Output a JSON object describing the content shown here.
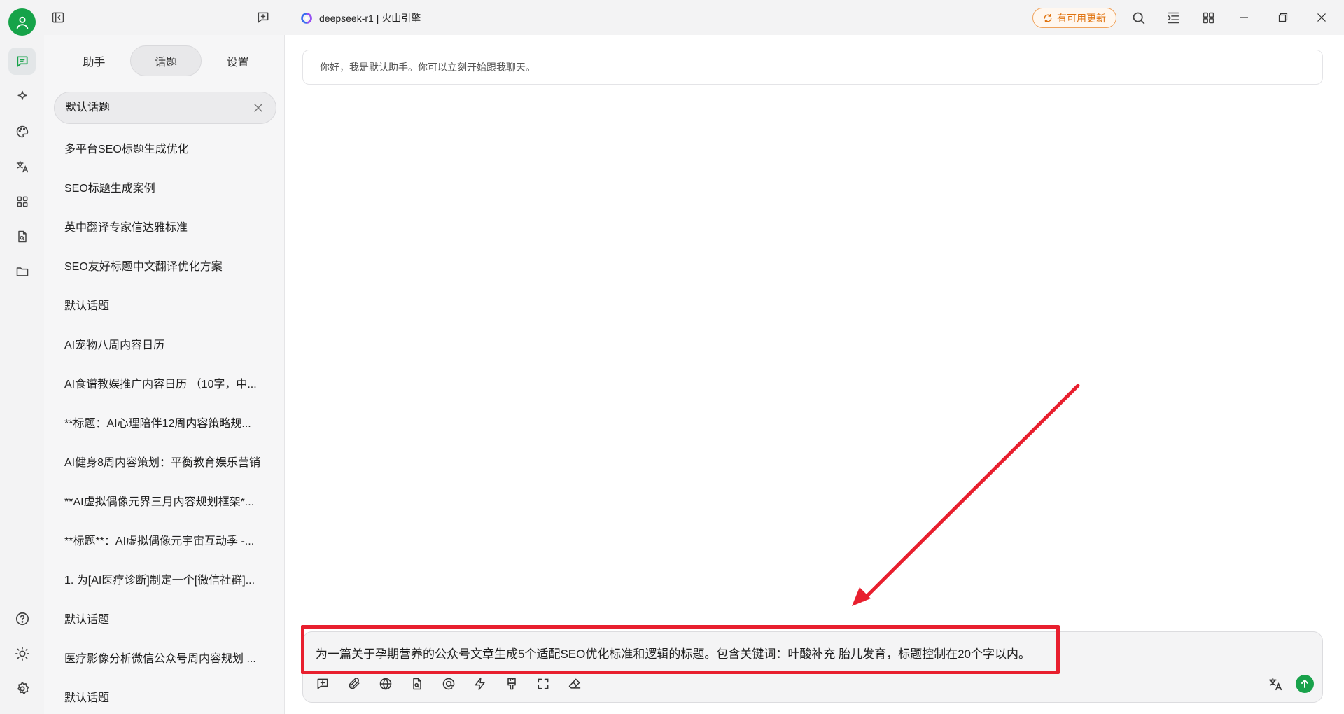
{
  "titlebar": {
    "model_label": "deepseek-r1 | 火山引擎",
    "update_label": "有可用更新"
  },
  "panel": {
    "tabs": [
      {
        "label": "助手"
      },
      {
        "label": "话题"
      },
      {
        "label": "设置"
      }
    ],
    "active_topic": "默认话题",
    "topics": [
      {
        "label": "多平台SEO标题生成优化"
      },
      {
        "label": "SEO标题生成案例"
      },
      {
        "label": "英中翻译专家信达雅标准"
      },
      {
        "label": "SEO友好标题中文翻译优化方案"
      },
      {
        "label": "默认话题"
      },
      {
        "label": "AI宠物八周内容日历"
      },
      {
        "label": "AI食谱教娱推广内容日历 （10字，中..."
      },
      {
        "label": "**标题：AI心理陪伴12周内容策略规..."
      },
      {
        "label": "AI健身8周内容策划：平衡教育娱乐营销"
      },
      {
        "label": "**AI虚拟偶像元界三月内容规划框架*..."
      },
      {
        "label": "**标题**：AI虚拟偶像元宇宙互动季 -..."
      },
      {
        "label": "1. 为[AI医疗诊断]制定一个[微信社群]..."
      },
      {
        "label": "默认话题"
      },
      {
        "label": "医疗影像分析微信公众号周内容规划 ..."
      },
      {
        "label": "默认话题"
      }
    ]
  },
  "chat": {
    "greeting": "你好，我是默认助手。你可以立刻开始跟我聊天。"
  },
  "composer": {
    "input_value": "为一篇关于孕期营养的公众号文章生成5个适配SEO优化标准和逻辑的标题。包含关键词：叶酸补充 胎儿发育，标题控制在20个字以内。"
  },
  "colors": {
    "brand_green": "#16a349",
    "annotation_red": "#e81f2e",
    "update_orange": "#e0730f"
  }
}
